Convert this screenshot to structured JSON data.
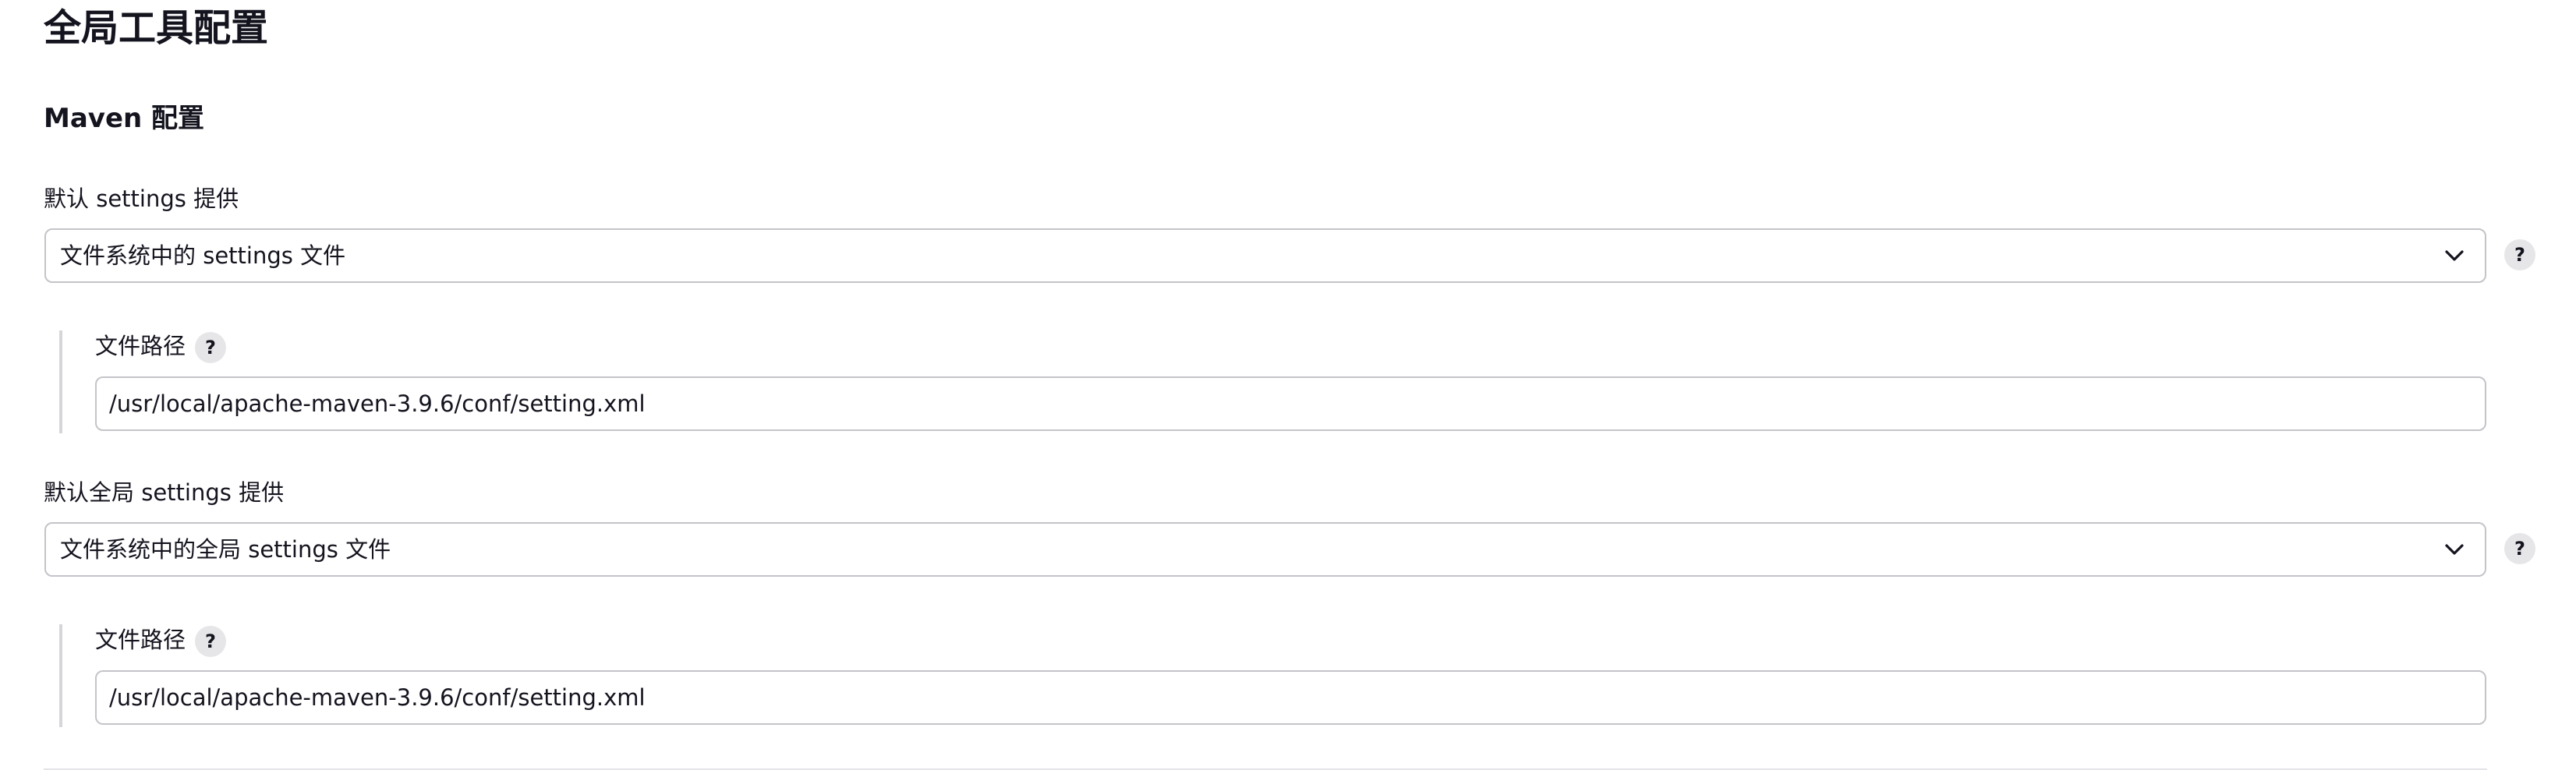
{
  "page": {
    "title": "全局工具配置"
  },
  "maven": {
    "section_title": "Maven 配置",
    "settings": {
      "label": "默认 settings 提供",
      "selected": "文件系统中的 settings 文件",
      "help": "?",
      "file_path_label": "文件路径",
      "file_path_help": "?",
      "file_path_value": "/usr/local/apache-maven-3.9.6/conf/setting.xml"
    },
    "global_settings": {
      "label": "默认全局 settings 提供",
      "selected": "文件系统中的全局 settings 文件",
      "help": "?",
      "file_path_label": "文件路径",
      "file_path_help": "?",
      "file_path_value": "/usr/local/apache-maven-3.9.6/conf/setting.xml"
    }
  },
  "icons": {
    "dropdown": "chevron-down-icon",
    "help": "help-icon"
  }
}
